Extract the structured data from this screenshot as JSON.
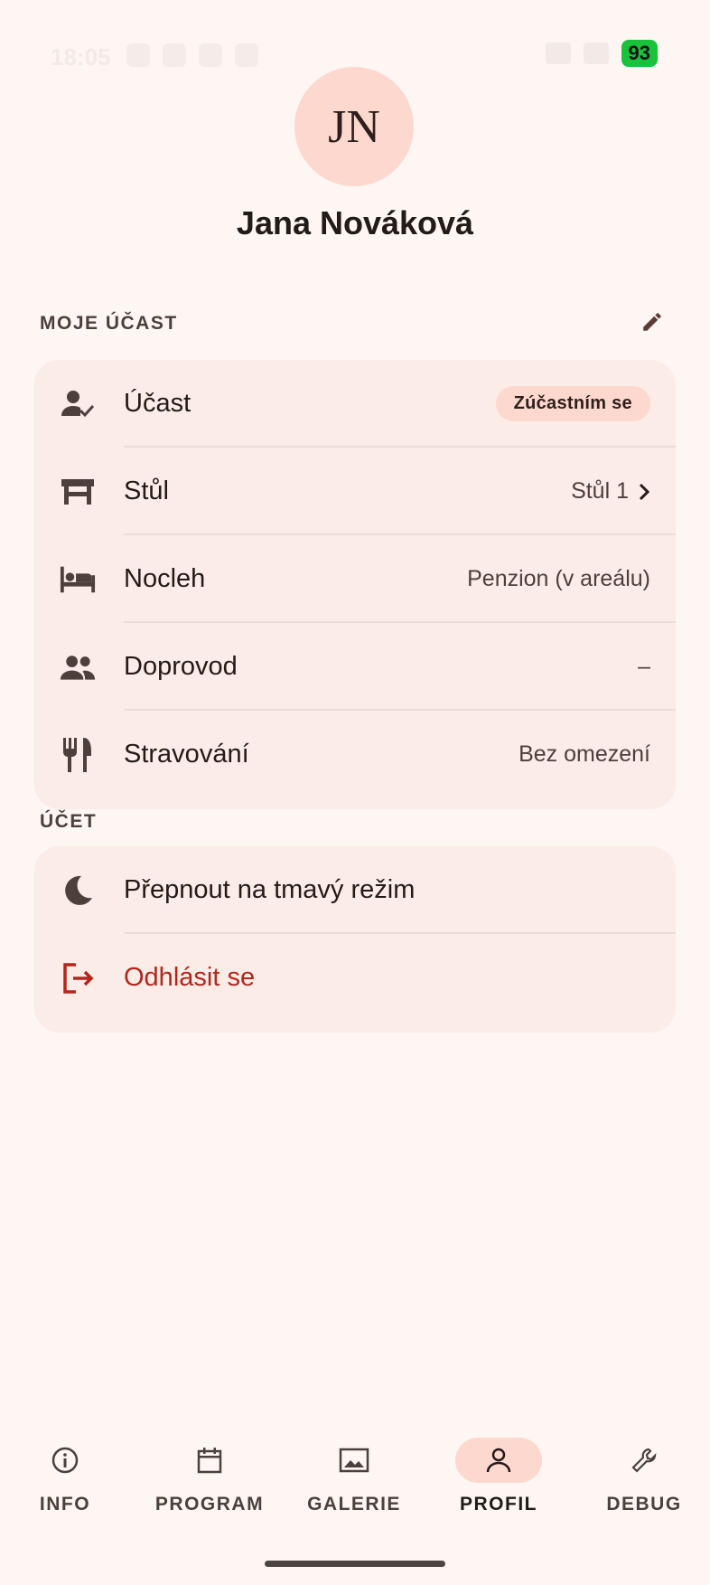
{
  "status_bar": {
    "time": "18:05",
    "battery": "93"
  },
  "profile": {
    "initials": "JN",
    "name": "Jana Nováková"
  },
  "participation": {
    "header": "MOJE ÚČAST",
    "rows": [
      {
        "icon": "person-check-icon",
        "label": "Účast",
        "value": "Zúčastním se"
      },
      {
        "icon": "table-icon",
        "label": "Stůl",
        "value": "Stůl 1"
      },
      {
        "icon": "bed-icon",
        "label": "Nocleh",
        "value": "Penzion (v areálu)"
      },
      {
        "icon": "people-icon",
        "label": "Doprovod",
        "value": "–"
      },
      {
        "icon": "restaurant-icon",
        "label": "Stravování",
        "value": "Bez omezení"
      }
    ]
  },
  "account": {
    "header": "ÚČET",
    "rows": [
      {
        "icon": "moon-icon",
        "label": "Přepnout na tmavý režim"
      },
      {
        "icon": "logout-icon",
        "label": "Odhlásit se"
      }
    ]
  },
  "colors": {
    "background": "#fdf6f3",
    "card": "#fbece7",
    "accent": "#fdd8cf",
    "danger": "#b3261e"
  },
  "nav": {
    "items": [
      {
        "icon": "info-icon",
        "label": "INFO"
      },
      {
        "icon": "calendar-icon",
        "label": "PROGRAM"
      },
      {
        "icon": "image-icon",
        "label": "GALERIE"
      },
      {
        "icon": "person-icon",
        "label": "PROFIL",
        "active": true
      },
      {
        "icon": "wrench-icon",
        "label": "DEBUG"
      }
    ]
  }
}
